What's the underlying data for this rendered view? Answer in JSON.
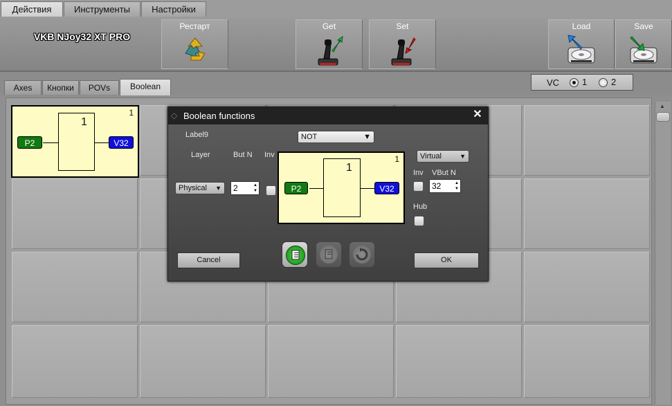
{
  "menu_tabs": [
    "Действия",
    "Инструменты",
    "Настройки"
  ],
  "app_title": "VKB NJoy32 XT PRO",
  "toolbar": {
    "restart": "Рестарт",
    "get": "Get",
    "set": "Set",
    "load": "Load",
    "save": "Save"
  },
  "sub_tabs": [
    "Axes",
    "Кнопки",
    "POVs",
    "Boolean"
  ],
  "vc": {
    "label": "VC",
    "option1": "1",
    "option2": "2",
    "selected": "1"
  },
  "grid_block": {
    "index": "1",
    "gate": "1",
    "input": "P2",
    "output": "V32"
  },
  "dialog": {
    "title": "Boolean functions",
    "close": "✕",
    "label9": "Label9",
    "function": "NOT",
    "layer_label": "Layer",
    "butn_label": "But N",
    "inv_label": "Inv",
    "layer_value": "Physical",
    "butn_value": "2",
    "target_layer": "Virtual",
    "inv2_label": "Inv",
    "vbutn_label": "VBut N",
    "vbutn_value": "32",
    "hub_label": "Hub",
    "block": {
      "index": "1",
      "gate": "1",
      "input": "P2",
      "output": "V32"
    },
    "cancel": "Cancel",
    "ok": "OK"
  },
  "colors": {
    "input_pin": "#117a11",
    "output_pin": "#1010dc",
    "block_fill": "#fefcc4"
  }
}
